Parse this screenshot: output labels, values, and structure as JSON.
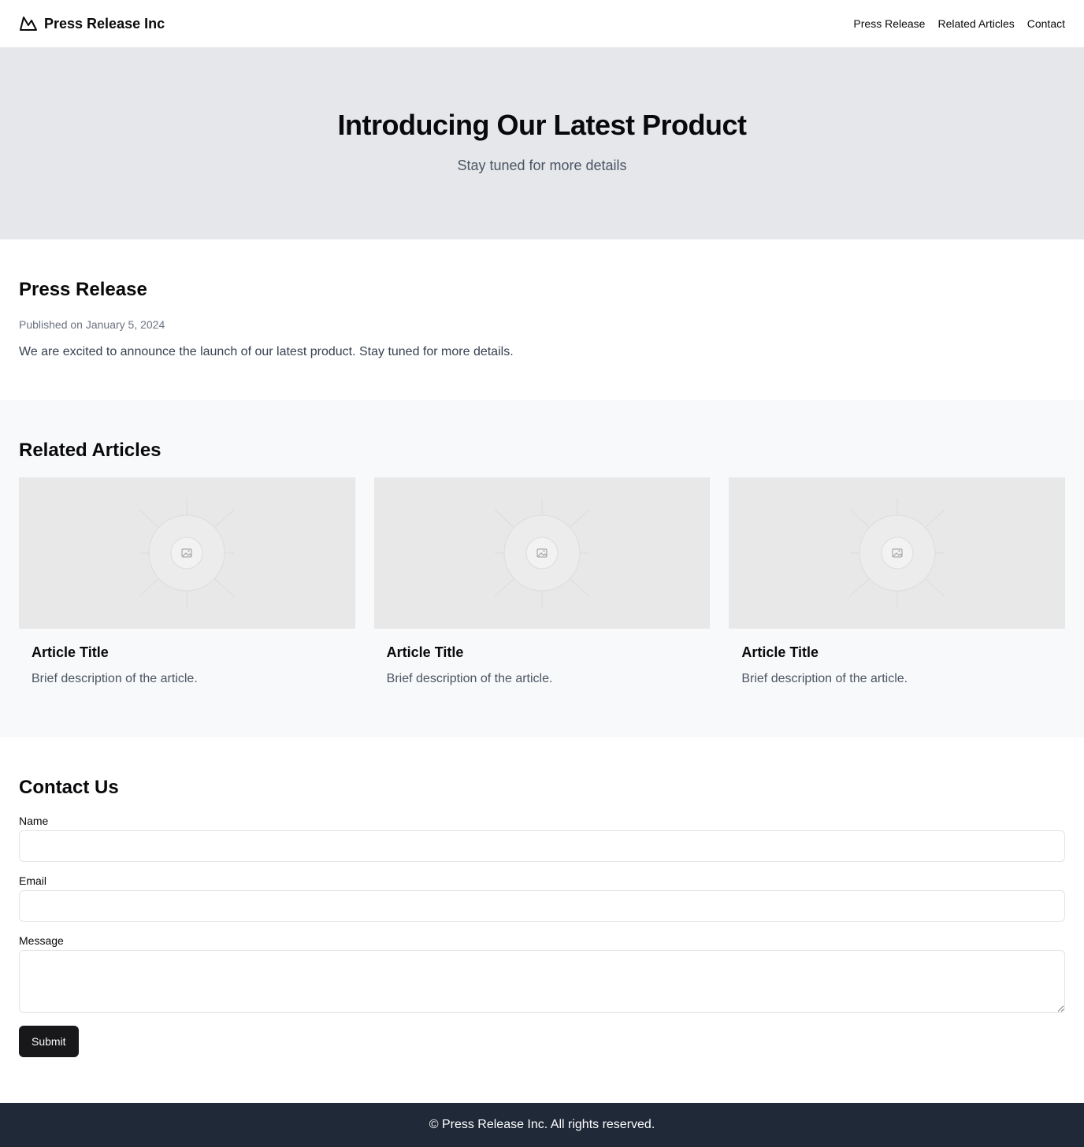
{
  "header": {
    "brand": "Press Release Inc",
    "logo_icon": "mountain-icon",
    "nav": [
      {
        "label": "Press Release"
      },
      {
        "label": "Related Articles"
      },
      {
        "label": "Contact"
      }
    ]
  },
  "hero": {
    "title": "Introducing Our Latest Product",
    "subtitle": "Stay tuned for more details"
  },
  "press": {
    "heading": "Press Release",
    "date": "Published on January 5, 2024",
    "body": "We are excited to announce the launch of our latest product. Stay tuned for more details."
  },
  "related": {
    "heading": "Related Articles",
    "articles": [
      {
        "title": "Article Title",
        "description": "Brief description of the article.",
        "image_icon": "image-placeholder-icon"
      },
      {
        "title": "Article Title",
        "description": "Brief description of the article.",
        "image_icon": "image-placeholder-icon"
      },
      {
        "title": "Article Title",
        "description": "Brief description of the article.",
        "image_icon": "image-placeholder-icon"
      }
    ]
  },
  "contact": {
    "heading": "Contact Us",
    "name_label": "Name",
    "name_value": "",
    "email_label": "Email",
    "email_value": "",
    "message_label": "Message",
    "message_value": "",
    "submit_label": "Submit"
  },
  "footer": {
    "text": "© Press Release Inc. All rights reserved."
  },
  "colors": {
    "hero_bg": "#e5e7eb",
    "related_bg": "#f8f9fa",
    "footer_bg": "#1f2937",
    "button_bg": "#18181b"
  }
}
